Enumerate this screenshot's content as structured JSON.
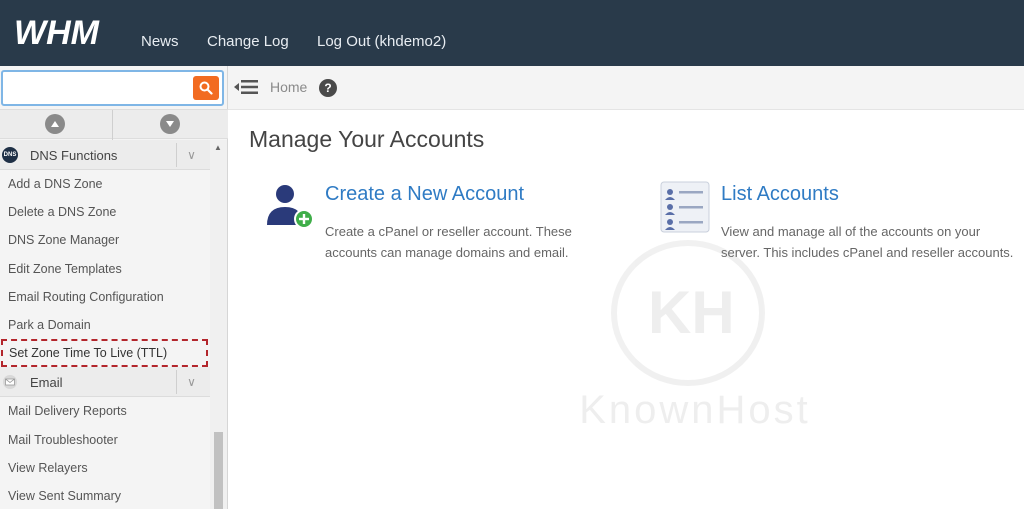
{
  "header": {
    "logo_text": "WHM",
    "nav": [
      {
        "label": "News"
      },
      {
        "label": "Change Log"
      },
      {
        "label": "Log Out (khdemo2)"
      }
    ]
  },
  "sidebar": {
    "search": {
      "value": "",
      "placeholder": ""
    },
    "groups": [
      {
        "label": "DNS Functions",
        "icon": "dns-icon",
        "icon_text": "DNS",
        "items": [
          {
            "label": "Add a DNS Zone"
          },
          {
            "label": "Delete a DNS Zone"
          },
          {
            "label": "DNS Zone Manager"
          },
          {
            "label": "Edit Zone Templates"
          },
          {
            "label": "Email Routing Configuration"
          },
          {
            "label": "Park a Domain"
          },
          {
            "label": "Set Zone Time To Live (TTL)",
            "highlighted": true
          }
        ]
      },
      {
        "label": "Email",
        "icon": "email-icon",
        "items": [
          {
            "label": "Mail Delivery Reports"
          },
          {
            "label": "Mail Troubleshooter"
          },
          {
            "label": "View Relayers"
          },
          {
            "label": "View Sent Summary"
          }
        ]
      }
    ]
  },
  "breadcrumb": {
    "home": "Home"
  },
  "main": {
    "title": "Manage Your Accounts",
    "cards": [
      {
        "title": "Create a New Account",
        "description": "Create a cPanel or reseller account. These accounts can manage domains and email.",
        "icon": "add-user-icon"
      },
      {
        "title": "List Accounts",
        "description": "View and manage all of the accounts on your server. This includes cPanel and reseller accounts.",
        "icon": "list-accounts-icon"
      }
    ]
  },
  "watermark": {
    "text": "KnownHost",
    "letter": "KH"
  },
  "colors": {
    "topbar": "#293a4a",
    "search_button": "#f26b21",
    "link": "#2f7bc4",
    "highlight_border": "#b3262c",
    "accent_green": "#3fae49"
  }
}
